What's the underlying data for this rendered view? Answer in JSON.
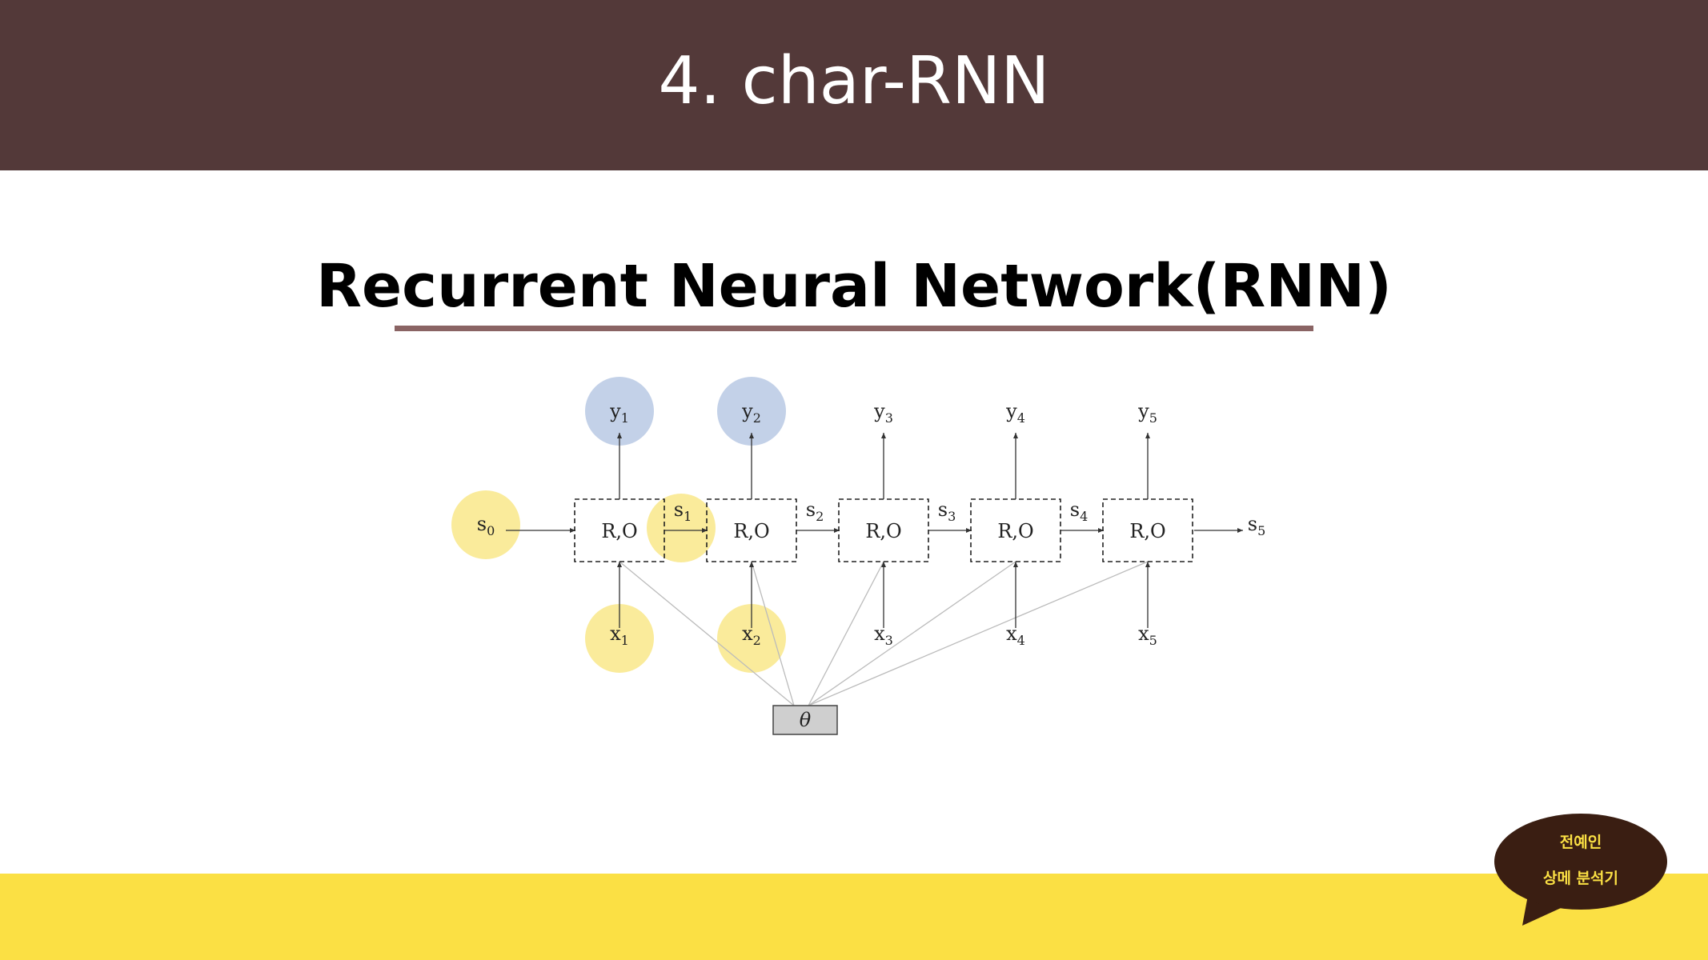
{
  "slide": {
    "title": "4. char-RNN",
    "subtitle": "Recurrent Neural Network(RNN)"
  },
  "colors": {
    "header": "#533939",
    "footer": "#fbe044",
    "underline": "#8a6464",
    "highlight_blue": "#b8c9e4",
    "highlight_yellow": "#f9e88a",
    "badge": "#3a1e12"
  },
  "diagram": {
    "cells": [
      "R,O",
      "R,O",
      "R,O",
      "R,O",
      "R,O"
    ],
    "outputs": [
      {
        "base": "y",
        "sub": "1"
      },
      {
        "base": "y",
        "sub": "2"
      },
      {
        "base": "y",
        "sub": "3"
      },
      {
        "base": "y",
        "sub": "4"
      },
      {
        "base": "y",
        "sub": "5"
      }
    ],
    "inputs": [
      {
        "base": "x",
        "sub": "1"
      },
      {
        "base": "x",
        "sub": "2"
      },
      {
        "base": "x",
        "sub": "3"
      },
      {
        "base": "x",
        "sub": "4"
      },
      {
        "base": "x",
        "sub": "5"
      }
    ],
    "states": [
      {
        "base": "s",
        "sub": "0"
      },
      {
        "base": "s",
        "sub": "1"
      },
      {
        "base": "s",
        "sub": "2"
      },
      {
        "base": "s",
        "sub": "3"
      },
      {
        "base": "s",
        "sub": "4"
      },
      {
        "base": "s",
        "sub": "5"
      }
    ],
    "params": "θ",
    "highlighted_blue": [
      "y1",
      "y2"
    ],
    "highlighted_yellow": [
      "s0",
      "s1",
      "x1",
      "x2"
    ]
  },
  "badge": {
    "line1": "전예인",
    "line2": "상메 분석기"
  }
}
